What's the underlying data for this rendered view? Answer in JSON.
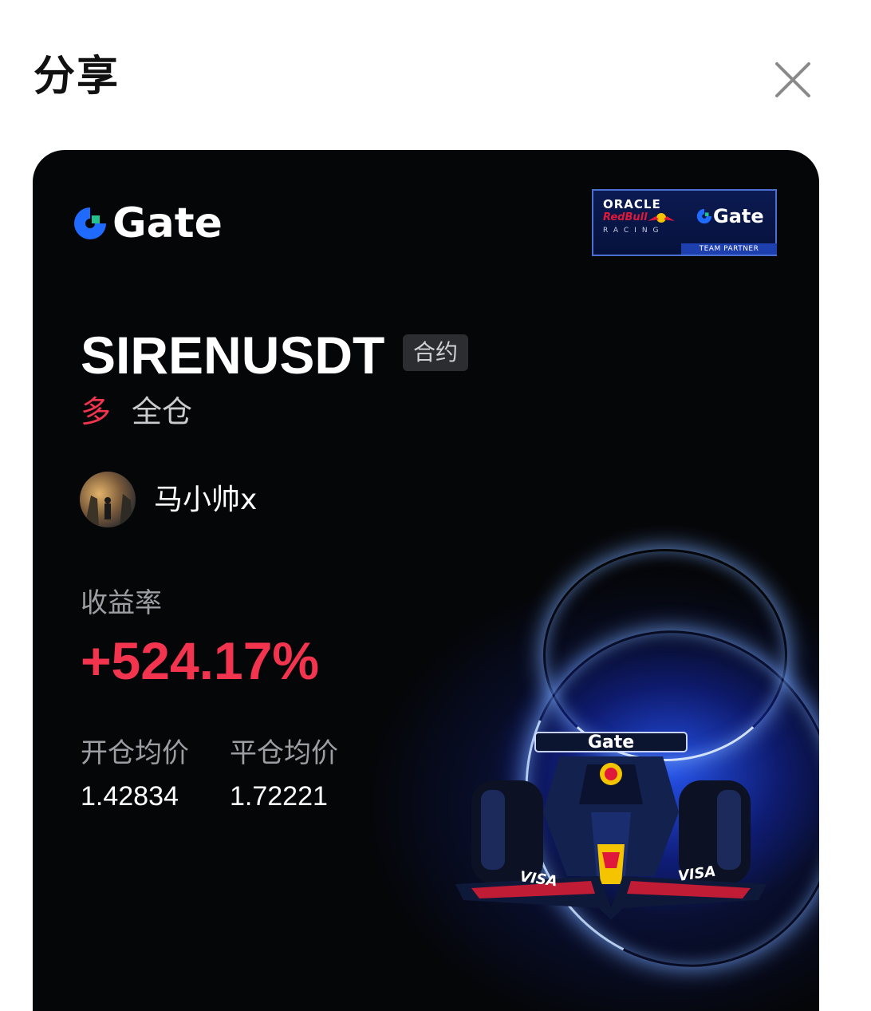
{
  "sheet": {
    "title": "分享",
    "close_icon": "close-icon"
  },
  "card": {
    "brand": "Gate",
    "partner": {
      "oracle": "ORACLE",
      "redbull": "RedBull",
      "racing": "RACING",
      "gate": "Gate",
      "tag": "TEAM PARTNER"
    },
    "pair": "SIRENUSDT",
    "badge": "合约",
    "direction": "多",
    "margin_mode": "全仓",
    "username": "马小帅x",
    "yield_label": "收益率",
    "yield_value": "+524.17%",
    "open_price_label": "开仓均价",
    "open_price": "1.42834",
    "close_price_label": "平仓均价",
    "close_price": "1.72221",
    "car_livery_text": "Gate"
  },
  "colors": {
    "accent_red": "#f2344f",
    "brand_blue": "#1f6bff",
    "card_bg": "#050608"
  }
}
